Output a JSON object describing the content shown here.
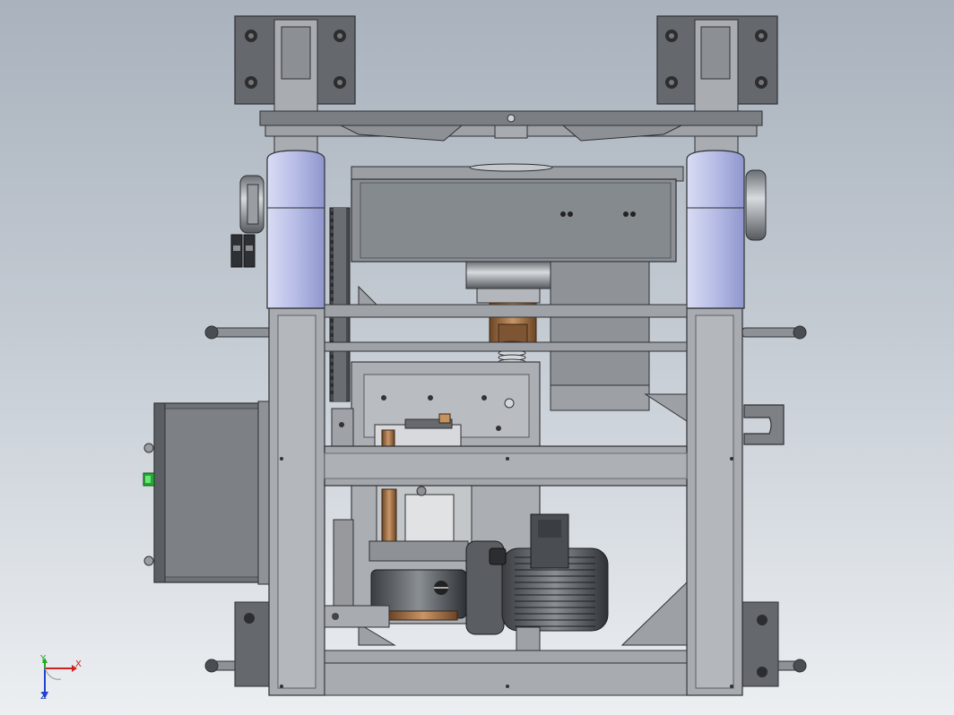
{
  "view": {
    "background_top": "#a9b2bd",
    "background_bottom": "#eceff2",
    "frame_color": "#a8acb0",
    "bracket_color": "#65686c",
    "housing_color": "#8e9398",
    "gearbox_color": "#7a7f85",
    "bronze_color": "#a4744a",
    "indicator_color": "#22aa33",
    "blue_shade": "#b8bde8"
  },
  "triad": {
    "x_label": "X",
    "y_label": "Y",
    "z_label": "Z",
    "x_color": "#cc2222",
    "y_color": "#22aa22",
    "z_color": "#2244cc"
  }
}
